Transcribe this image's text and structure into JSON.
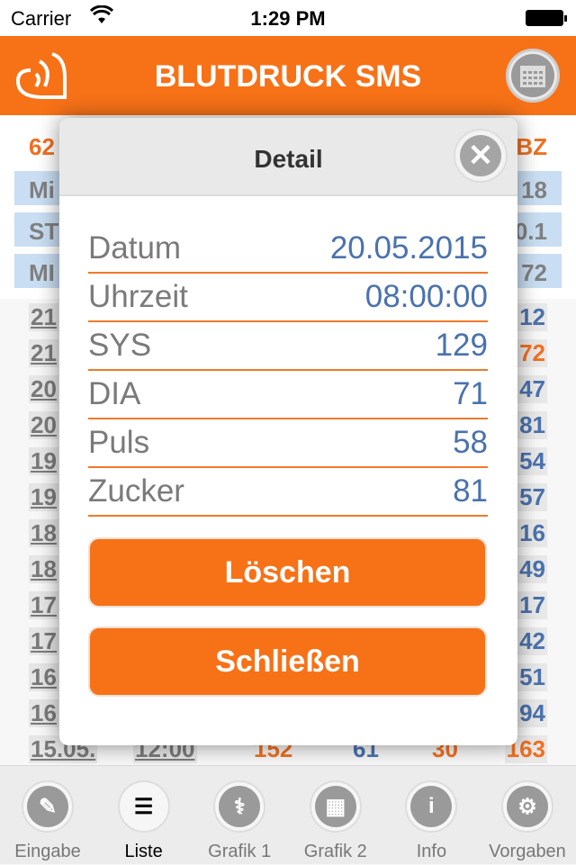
{
  "status_bar": {
    "carrier": "Carrier",
    "time": "1:29 PM"
  },
  "header": {
    "title": "BLUTDRUCK SMS",
    "logo_icon": "heart-signal-icon",
    "calendar_icon": "calendar-icon"
  },
  "background_list": {
    "summary_header": {
      "left": "62",
      "right": "BZ"
    },
    "summary_rows": [
      {
        "left": "Mi",
        "right": "18"
      },
      {
        "left": "ST",
        "right": "0.1"
      },
      {
        "left": "MI",
        "right": "72"
      }
    ],
    "rows": [
      {
        "date": "21",
        "bz": "12",
        "bz_high": false
      },
      {
        "date": "21",
        "bz": "72",
        "bz_high": true
      },
      {
        "date": "20",
        "bz": "47",
        "bz_high": false
      },
      {
        "date": "20",
        "bz": "81",
        "bz_high": false
      },
      {
        "date": "19",
        "bz": "54",
        "bz_high": false
      },
      {
        "date": "19",
        "bz": "57",
        "bz_high": false
      },
      {
        "date": "18",
        "bz": "16",
        "bz_high": false
      },
      {
        "date": "18",
        "bz": "49",
        "bz_high": false
      },
      {
        "date": "17",
        "bz": "17",
        "bz_high": false
      },
      {
        "date": "17",
        "bz": "42",
        "bz_high": false
      },
      {
        "date": "16",
        "bz": "51",
        "bz_high": false
      },
      {
        "date": "16",
        "bz": "94",
        "bz_high": false
      }
    ],
    "last_row": {
      "date": "15.05.",
      "time": "12:00",
      "sys": "152",
      "dia": "61",
      "puls": "30",
      "bz": "163"
    }
  },
  "modal": {
    "title": "Detail",
    "close_icon": "close-icon",
    "fields": [
      {
        "label": "Datum",
        "value": "20.05.2015"
      },
      {
        "label": "Uhrzeit",
        "value": "08:00:00"
      },
      {
        "label": "SYS",
        "value": "129"
      },
      {
        "label": "DIA",
        "value": "71"
      },
      {
        "label": "Puls",
        "value": "58"
      },
      {
        "label": "Zucker",
        "value": "81"
      }
    ],
    "delete_label": "Löschen",
    "close_label": "Schließen"
  },
  "tabs": [
    {
      "label": "Eingabe",
      "icon": "pencil-icon",
      "glyph": "✎"
    },
    {
      "label": "Liste",
      "icon": "list-icon",
      "glyph": "☰",
      "active": true
    },
    {
      "label": "Grafik 1",
      "icon": "caduceus-icon",
      "glyph": "⚕"
    },
    {
      "label": "Grafik 2",
      "icon": "chart-icon",
      "glyph": "▦"
    },
    {
      "label": "Info",
      "icon": "info-icon",
      "glyph": "i"
    },
    {
      "label": "Vorgaben",
      "icon": "gear-icon",
      "glyph": "⚙"
    }
  ],
  "colors": {
    "accent": "#f77117",
    "value_blue": "#4a72ad",
    "label_grey": "#7a7a7a",
    "summary_blue": "#c9def3"
  }
}
